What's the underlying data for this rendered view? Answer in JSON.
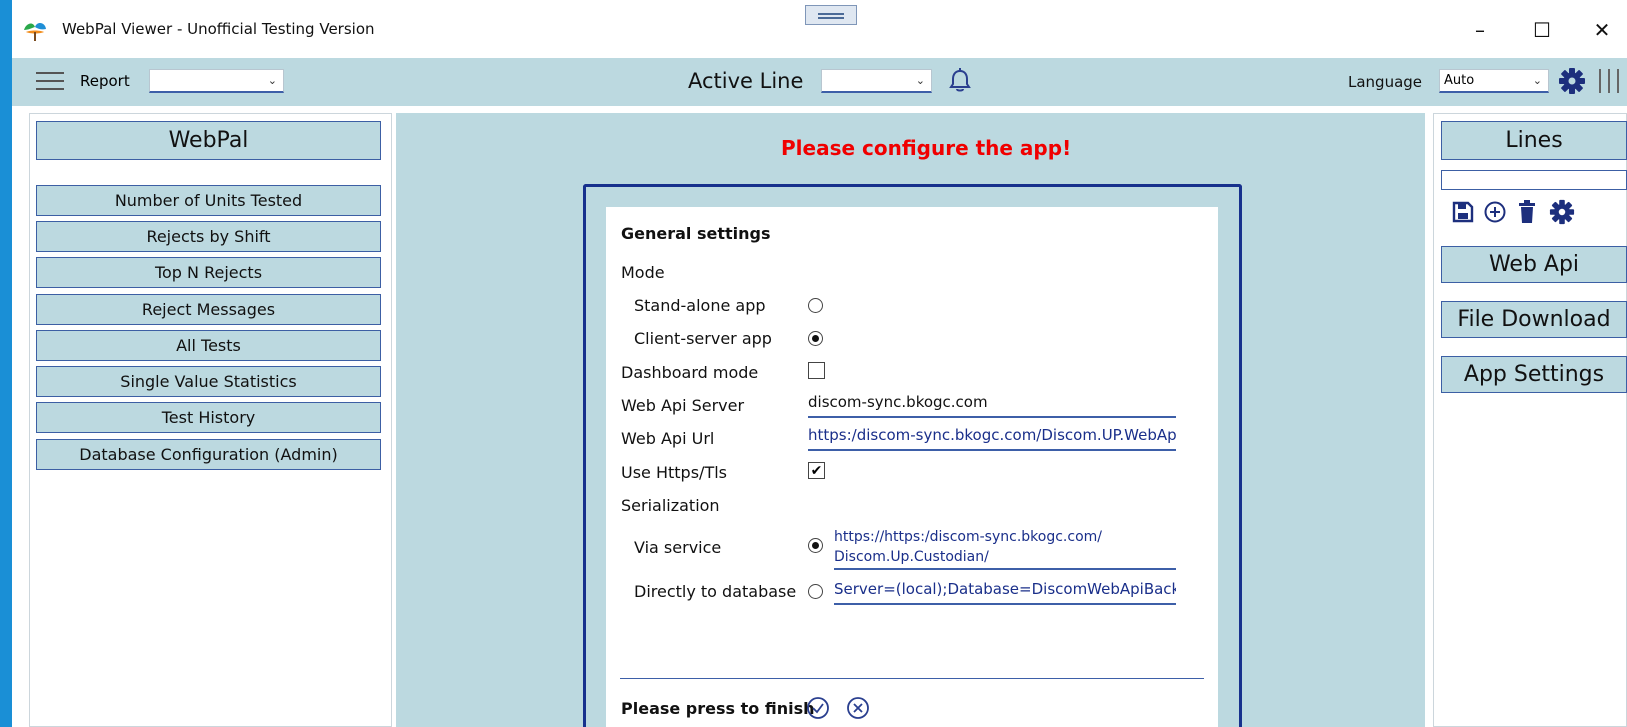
{
  "window": {
    "title": "WebPal Viewer - Unofficial Testing Version",
    "minimize": "–",
    "maximize": "☐",
    "close": "✕"
  },
  "toolbar": {
    "report_label": "Report",
    "report_value": "",
    "active_line_label": "Active Line",
    "active_line_value": "",
    "language_label": "Language",
    "language_value": "Auto",
    "chevron": "⌄"
  },
  "left_menu": {
    "header": "WebPal",
    "items": [
      "Number of Units Tested",
      "Rejects by Shift",
      "Top N Rejects",
      "Reject Messages",
      "All Tests",
      "Single Value Statistics",
      "Test History",
      "Database Configuration (Admin)"
    ]
  },
  "center": {
    "message": "Please configure the app!",
    "message_color": "#f00000"
  },
  "settings": {
    "title": "General settings",
    "mode_label": "Mode",
    "standalone_label": "Stand-alone app",
    "standalone_selected": false,
    "client_server_label": "Client-server app",
    "client_server_selected": true,
    "dashboard_label": "Dashboard mode",
    "dashboard_checked": false,
    "web_api_server_label": "Web Api Server",
    "web_api_server_value": "discom-sync.bkogc.com",
    "web_api_url_label": "Web Api Url",
    "web_api_url_value": "https:/discom-sync.bkogc.com/Discom.UP.WebApi",
    "use_https_label": "Use Https/Tls",
    "use_https_checked": true,
    "check_mark": "✔",
    "serialization_label": "Serialization",
    "via_service_label": "Via service",
    "via_service_selected": true,
    "via_service_value": "https://https:/discom-sync.bkogc.com/ Discom.Up.Custodian/",
    "direct_db_label": "Directly to database",
    "direct_db_selected": false,
    "direct_db_value": "Server=(local);Database=DiscomWebApiBacke",
    "finish_label": "Please press to finish"
  },
  "right_panel": {
    "lines_header": "Lines",
    "lines_input_value": "",
    "web_api_button": "Web Api",
    "file_download_button": "File Download",
    "app_settings_button": "App Settings"
  },
  "colors": {
    "toolbar_bg": "#bcd9e0",
    "accent_blue": "#3c5fa4",
    "dialog_border": "#17318d",
    "icon_blue": "#1d2f7d"
  }
}
